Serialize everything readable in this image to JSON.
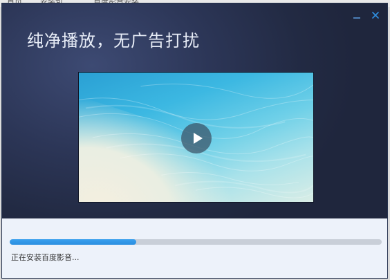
{
  "background_strip": {
    "text_a": "首页",
    "text_b": "安装包",
    "text_c": "百度影音安装"
  },
  "window": {
    "headline": "纯净播放，无广告打扰",
    "controls": {
      "minimize_icon": "minimize-icon",
      "close_icon": "close-icon"
    }
  },
  "preview": {
    "play_icon": "play-icon"
  },
  "install": {
    "progress": 0.34,
    "status_text": "正在安装百度影音..."
  },
  "colors": {
    "accent": "#2a8ee0",
    "hero_bg": "#2c3657",
    "footer_bg": "#edf2fa"
  }
}
